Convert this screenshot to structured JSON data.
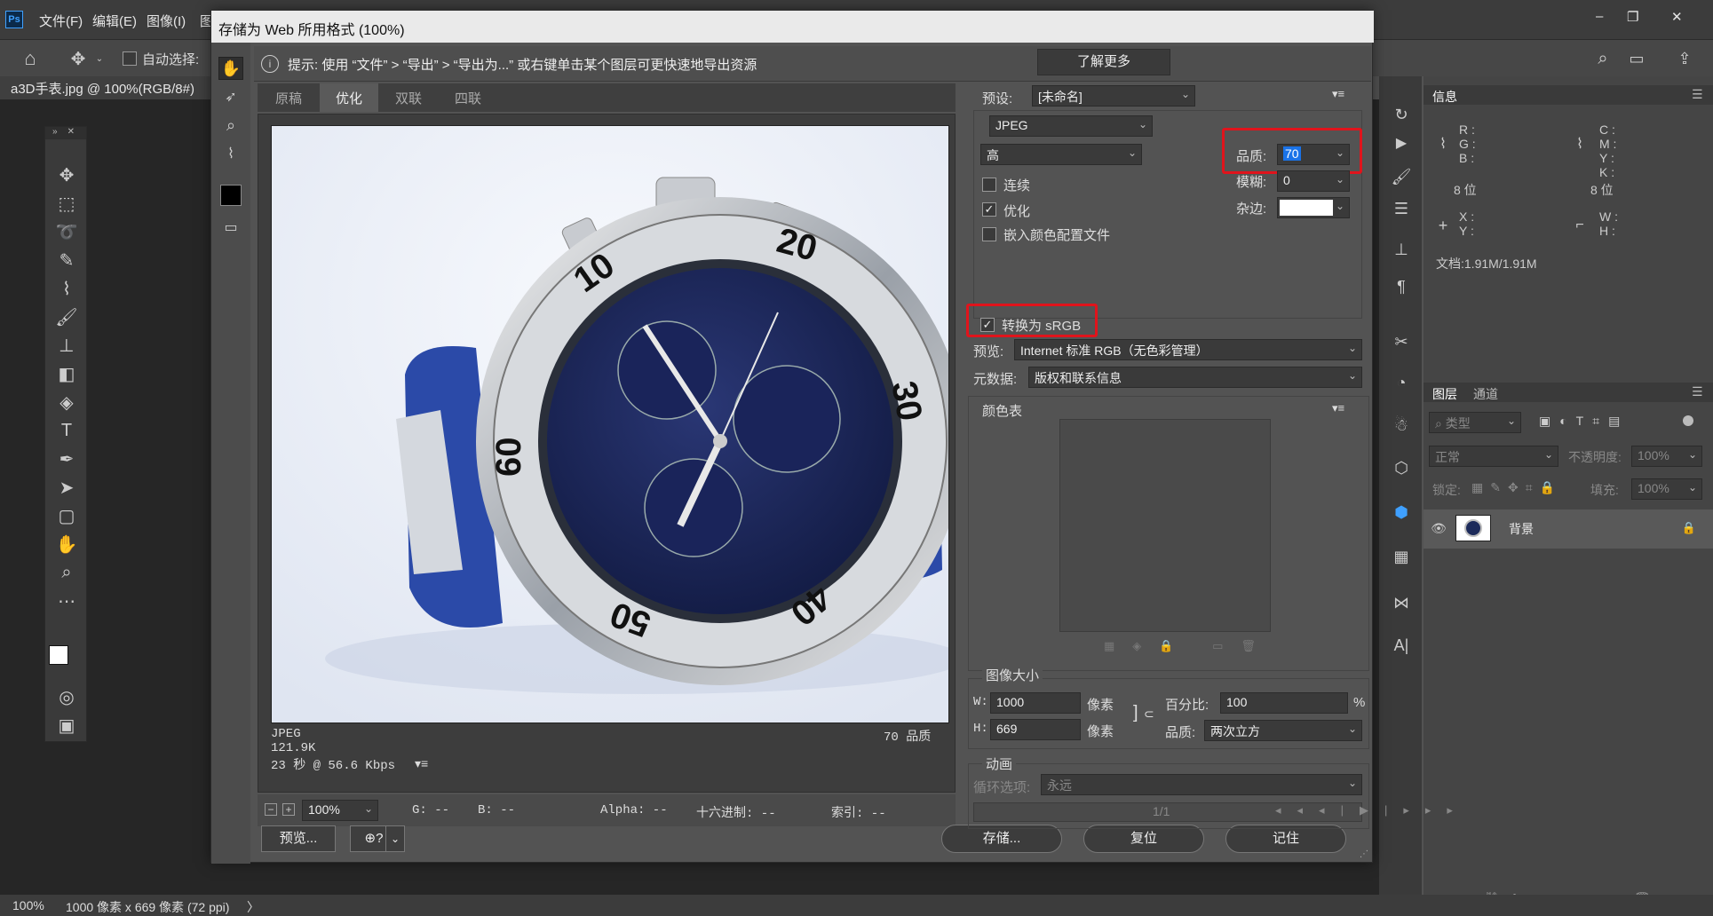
{
  "app": {
    "logo": "Ps",
    "menu": [
      "文件(F)",
      "编辑(E)",
      "图像(I)",
      "图"
    ],
    "window_controls": [
      "–",
      "❐",
      "✕"
    ],
    "auto_select_label": "自动选择:",
    "doc_tab": "a3D手表.jpg @ 100%(RGB/8#) *",
    "status": {
      "zoom": "100%",
      "dimensions": "1000 像素 x 669 像素 (72 ppi)",
      "arrow": "〉"
    }
  },
  "dialog": {
    "title": "存储为 Web 所用格式 (100%)",
    "hint": "提示: 使用 “文件” > “导出” > “导出为...” 或右键单击某个图层可更快速地导出资源",
    "learn_more": "了解更多",
    "view_tabs": [
      "原稿",
      "优化",
      "双联",
      "四联"
    ],
    "active_tab": "优化",
    "preview_info": {
      "format": "JPEG",
      "size": "121.9K",
      "time": "23 秒 @ 56.6 Kbps",
      "quality": "70 品质"
    },
    "bottom": {
      "zoom": "100%",
      "g": "G: --",
      "b": "B: --",
      "alpha": "Alpha: --",
      "hex": "十六进制: --",
      "index": "索引: --"
    },
    "preview_button": "预览...",
    "save_button": "存储...",
    "reset_button": "复位",
    "remember_button": "记住",
    "settings": {
      "preset_label": "预设:",
      "preset_value": "[未命名]",
      "format": "JPEG",
      "quality_level": "高",
      "quality_label": "品质:",
      "quality_value": "70",
      "blur_label": "模糊:",
      "blur_value": "0",
      "matte_label": "杂边:",
      "progressive_label": "连续",
      "progressive_checked": false,
      "optimized_label": "优化",
      "optimized_checked": true,
      "embed_profile_label": "嵌入颜色配置文件",
      "embed_profile_checked": false,
      "convert_srgb_label": "转换为 sRGB",
      "convert_srgb_checked": true,
      "preview_label": "预览:",
      "preview_value": "Internet 标准 RGB（无色彩管理）",
      "metadata_label": "元数据:",
      "metadata_value": "版权和联系信息",
      "color_table_label": "颜色表",
      "image_size_label": "图像大小",
      "w_label": "W:",
      "w_value": "1000",
      "h_label": "H:",
      "h_value": "669",
      "unit": "像素",
      "percent_label": "百分比:",
      "percent_value": "100",
      "percent_unit": "%",
      "resample_label": "品质:",
      "resample_value": "两次立方",
      "animation_label": "动画",
      "loop_label": "循环选项:",
      "loop_value": "永远",
      "frame_counter": "1/1"
    }
  },
  "panels": {
    "info_tab": "信息",
    "rgb_labels": "R :\nG :\nB :",
    "cmyk_labels": "C :\nM :\nY :\nK :",
    "bit_left": "8 位",
    "bit_right": "8 位",
    "xy_labels": "X :\nY :",
    "wh_labels": "W :\nH :",
    "doc_size": "文档:1.91M/1.91M",
    "layers_tab": "图层",
    "channels_tab": "通道",
    "filter_kind": "类型",
    "blend_mode": "正常",
    "opacity_label": "不透明度:",
    "opacity_value": "100%",
    "lock_label": "锁定:",
    "fill_label": "填充:",
    "fill_value": "100%",
    "layer_name": "背景"
  },
  "colors": {
    "highlight_red": "#e0141c",
    "selection_blue": "#1a73e8",
    "dialog_bg": "#535353"
  }
}
